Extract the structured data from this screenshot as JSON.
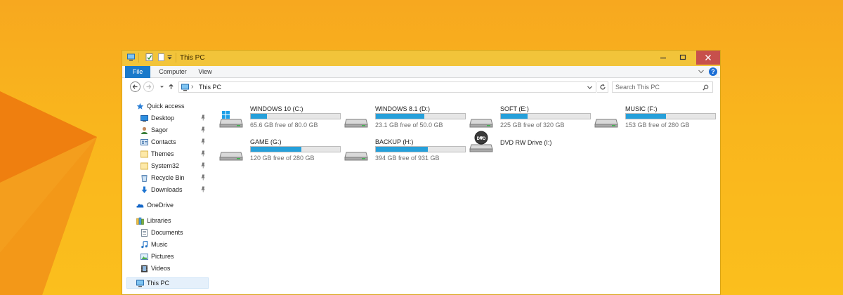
{
  "window": {
    "title": "This PC"
  },
  "ribbon": {
    "tabs": [
      "File",
      "Computer",
      "View"
    ]
  },
  "address": {
    "separator": "›",
    "path": "This PC"
  },
  "search": {
    "placeholder": "Search This PC"
  },
  "nav": {
    "quick_access": "Quick access",
    "quick_items": [
      {
        "label": "Desktop",
        "icon": "desktop-icon"
      },
      {
        "label": "Sagor",
        "icon": "user-folder-icon"
      },
      {
        "label": "Contacts",
        "icon": "contacts-icon"
      },
      {
        "label": "Themes",
        "icon": "folder-icon"
      },
      {
        "label": "System32",
        "icon": "folder-icon"
      },
      {
        "label": "Recycle Bin",
        "icon": "recycle-bin-icon"
      },
      {
        "label": "Downloads",
        "icon": "downloads-icon"
      }
    ],
    "onedrive": "OneDrive",
    "libraries": "Libraries",
    "library_items": [
      {
        "label": "Documents",
        "icon": "documents-icon"
      },
      {
        "label": "Music",
        "icon": "music-icon"
      },
      {
        "label": "Pictures",
        "icon": "pictures-icon"
      },
      {
        "label": "Videos",
        "icon": "videos-icon"
      }
    ],
    "this_pc": "This PC"
  },
  "drives": [
    {
      "name": "WINDOWS 10 (C:)",
      "free": "65.6 GB free of 80.0 GB",
      "used_fraction": 0.18,
      "icon": "windows-drive-icon"
    },
    {
      "name": "WINDOWS 8.1 (D:)",
      "free": "23.1 GB free of 50.0 GB",
      "used_fraction": 0.54,
      "icon": "hard-drive-icon"
    },
    {
      "name": "SOFT (E:)",
      "free": "225 GB free of 320 GB",
      "used_fraction": 0.3,
      "icon": "hard-drive-icon"
    },
    {
      "name": "MUSIC (F:)",
      "free": "153 GB free of 280 GB",
      "used_fraction": 0.45,
      "icon": "hard-drive-icon"
    },
    {
      "name": "GAME (G:)",
      "free": "120 GB free of 280 GB",
      "used_fraction": 0.57,
      "icon": "hard-drive-icon"
    },
    {
      "name": "BACKUP (H:)",
      "free": "394 GB free of 931 GB",
      "used_fraction": 0.58,
      "icon": "hard-drive-icon"
    },
    {
      "name": "DVD RW Drive (I:)",
      "free": "",
      "used_fraction": null,
      "icon": "dvd-drive-icon"
    }
  ],
  "colors": {
    "wallpaper": "#f9b51d",
    "titlebar": "#f2c43a",
    "file_tab": "#1979ca",
    "usage_bar": "#26a0da",
    "close_button": "#c7504c"
  }
}
